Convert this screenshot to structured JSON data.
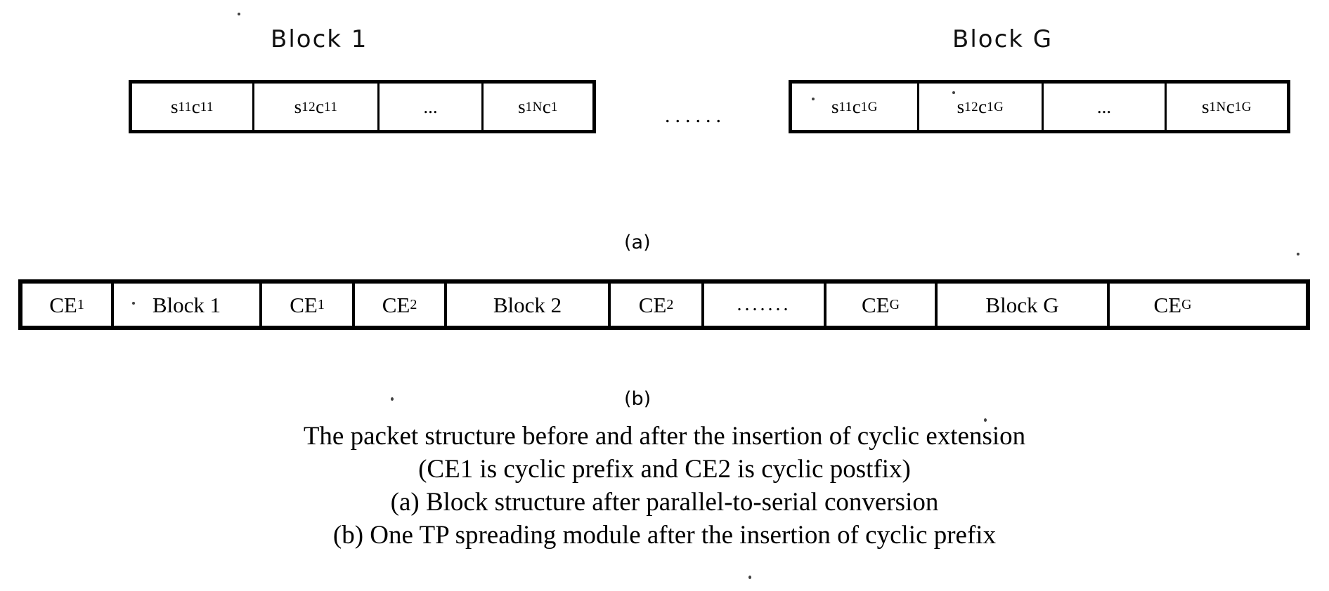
{
  "figure": {
    "part_a": {
      "label": "(a)",
      "blocks": [
        {
          "title": "Block 1",
          "cells": [
            {
              "main1": "s",
              "sub1": "11",
              "main2": "c",
              "sub2": "11"
            },
            {
              "main1": "s",
              "sub1": "12",
              "main2": "c",
              "sub2": "11"
            },
            {
              "main1": "...",
              "sub1": "",
              "main2": "",
              "sub2": ""
            },
            {
              "main1": "s",
              "sub1": "1N",
              "main2": "c",
              "sub2": "1"
            }
          ]
        },
        {
          "title": "Block G",
          "cells": [
            {
              "main1": "s",
              "sub1": "11",
              "main2": "c",
              "sub2": "1G"
            },
            {
              "main1": "s",
              "sub1": "12",
              "main2": "c",
              "sub2": "1G"
            },
            {
              "main1": "...",
              "sub1": "",
              "main2": "",
              "sub2": ""
            },
            {
              "main1": "s",
              "sub1": "1N",
              "main2": "c",
              "sub2": "1G"
            }
          ]
        }
      ],
      "between_blocks_dots": "......"
    },
    "part_b": {
      "label": "(b)",
      "cells": [
        {
          "main": "CE",
          "sub": "1"
        },
        {
          "main": "Block 1",
          "sub": ""
        },
        {
          "main": "CE",
          "sub": "1"
        },
        {
          "main": "CE",
          "sub": "2"
        },
        {
          "main": "Block 2",
          "sub": ""
        },
        {
          "main": "CE",
          "sub": "2"
        },
        {
          "main": ".......",
          "sub": ""
        },
        {
          "main": "CE",
          "sub": "G"
        },
        {
          "main": "Block G",
          "sub": ""
        },
        {
          "main": "CE",
          "sub": "G"
        }
      ]
    },
    "caption": {
      "line1": "The packet structure before and after the insertion of cyclic extension",
      "line2": "(CE1 is cyclic prefix and CE2 is cyclic postfix)",
      "line3": "(a) Block structure after parallel-to-serial conversion",
      "line4": "(b) One TP spreading module after the insertion of cyclic prefix"
    }
  },
  "colors": {
    "ink": "#000000",
    "paper": "#ffffff"
  }
}
